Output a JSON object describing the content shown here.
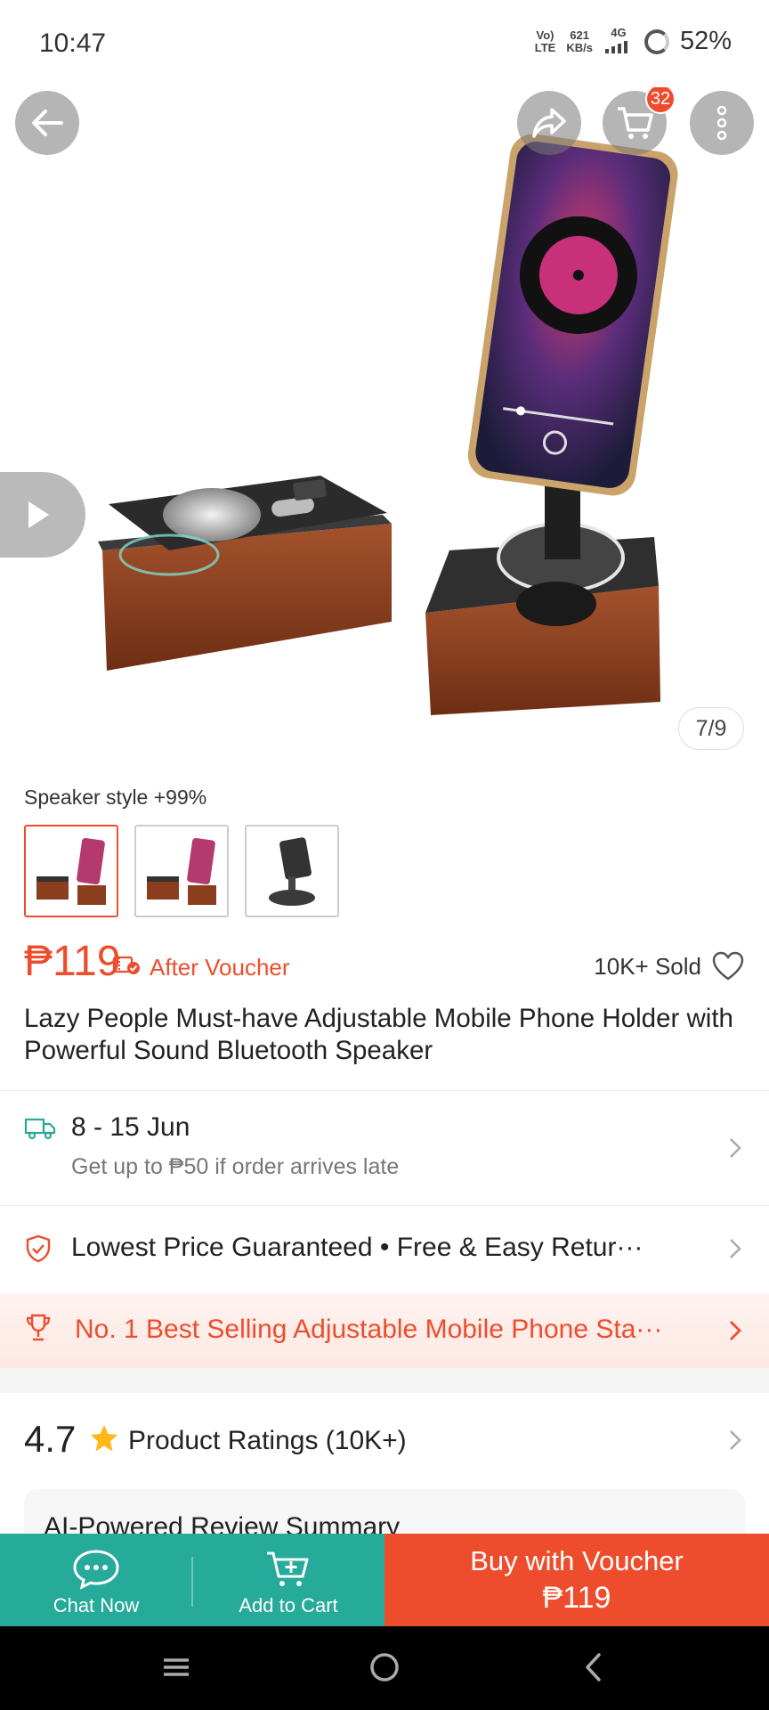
{
  "status_bar": {
    "time": "10:47",
    "volte": "VoLTE",
    "speed_value": "621",
    "speed_unit": "KB/s",
    "network": "4G",
    "battery": "52%"
  },
  "hero": {
    "cart_count": "32",
    "image_counter": "7/9"
  },
  "variants": {
    "label": "Speaker style +99%",
    "selected_index": 0
  },
  "price": {
    "value": "₱119",
    "voucher_text": "After Voucher",
    "sold": "10K+ Sold"
  },
  "product": {
    "title": "Lazy People Must-have Adjustable Mobile Phone Holder with Powerful Sound Bluetooth Speaker"
  },
  "delivery": {
    "date": "8 - 15 Jun",
    "note": "Get up to ₱50 if order arrives late"
  },
  "guarantee": {
    "text": "Lowest Price Guaranteed  •  Free & Easy Retur···"
  },
  "best_seller": {
    "text": "No. 1 Best Selling Adjustable Mobile Phone Sta···"
  },
  "ratings": {
    "score": "4.7",
    "label": "Product Ratings (10K+)"
  },
  "review_summary": {
    "title": "AI-Powered Review Summary"
  },
  "action_bar": {
    "chat_label": "Chat Now",
    "cart_label": "Add to Cart",
    "buy_line1": "Buy with Voucher",
    "buy_line2": "₱119"
  },
  "colors": {
    "accent": "#ee4d2d",
    "teal": "#26aa99"
  }
}
